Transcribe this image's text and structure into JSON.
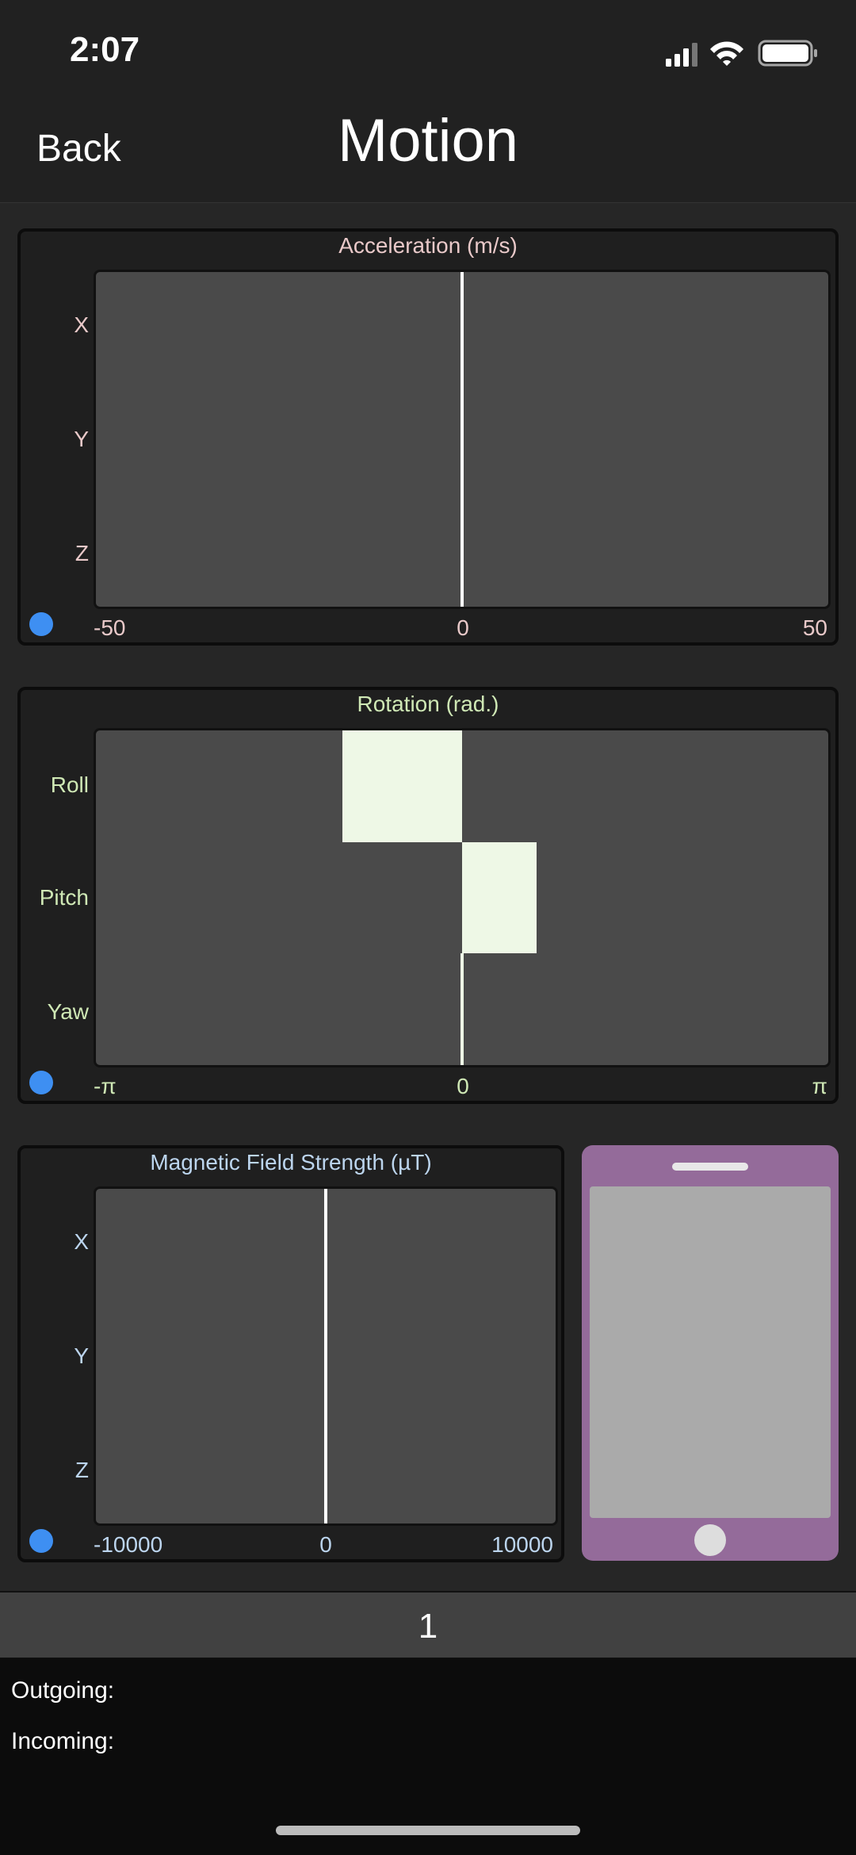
{
  "status_bar": {
    "time": "2:07"
  },
  "nav": {
    "back_label": "Back",
    "title": "Motion"
  },
  "acceleration": {
    "title": "Acceleration (m/s)",
    "rows": [
      "X",
      "Y",
      "Z"
    ],
    "ticks": {
      "min": "-50",
      "mid": "0",
      "max": "50"
    },
    "range": [
      -50,
      50
    ],
    "values": [
      0.2,
      0.0,
      -0.3
    ],
    "bar_color": "#ffffff",
    "status_color": "#3e8ff2"
  },
  "rotation": {
    "title": "Rotation (rad.)",
    "rows": [
      "Roll",
      "Pitch",
      "Yaw"
    ],
    "ticks": {
      "min": "-π",
      "mid": "0",
      "max": "π"
    },
    "range": [
      -3.14159,
      3.14159
    ],
    "values": [
      -1.03,
      0.64,
      0.02
    ],
    "bar_color": "#eef8e6",
    "status_color": "#3e8ff2"
  },
  "magnetic": {
    "title": "Magnetic Field Strength (µT)",
    "rows": [
      "X",
      "Y",
      "Z"
    ],
    "ticks": {
      "min": "-10000",
      "mid": "0",
      "max": "10000"
    },
    "range": [
      -10000,
      10000
    ],
    "values": [
      20,
      0,
      30
    ],
    "bar_color": "#ffffff",
    "status_color": "#3e8ff2"
  },
  "phone_preview": {
    "body_color": "#946b9a",
    "screen_color": "#aaaaaa"
  },
  "counter": {
    "value": "1"
  },
  "console": {
    "outgoing_label": "Outgoing:",
    "incoming_label": "Incoming:"
  }
}
